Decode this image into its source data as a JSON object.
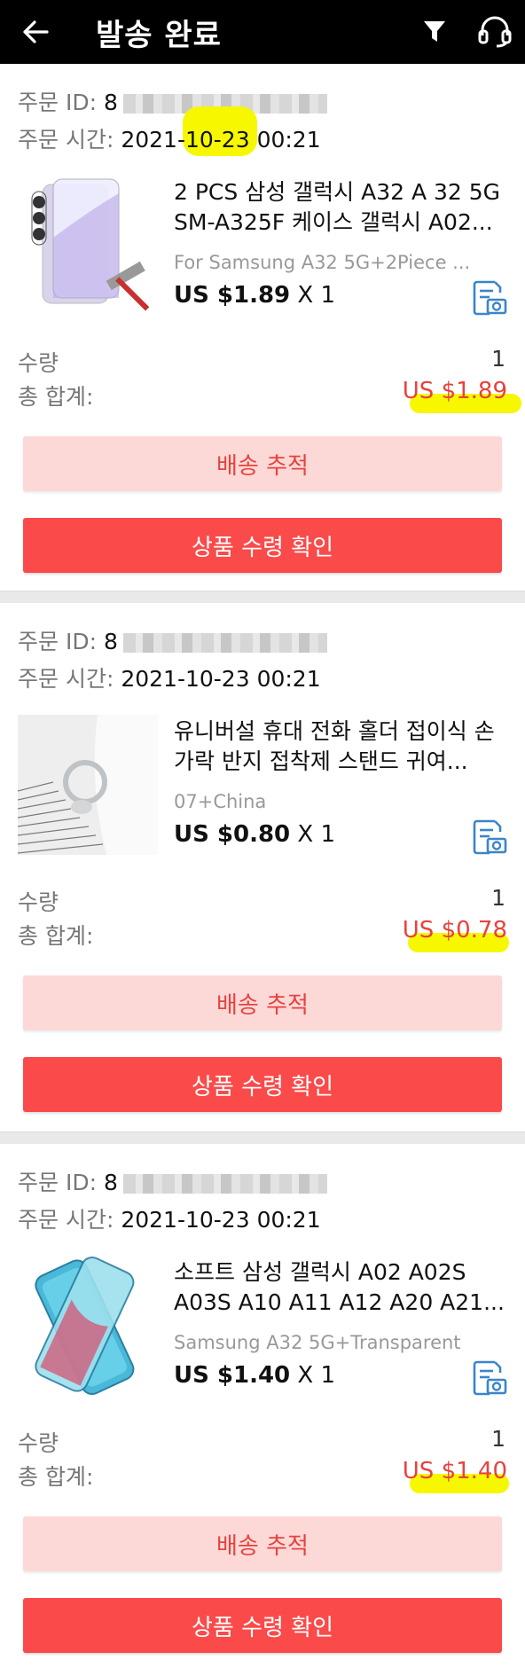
{
  "header": {
    "title": "발송 완료",
    "icons": [
      "back-arrow-icon",
      "filter-icon",
      "headset-icon"
    ]
  },
  "labels": {
    "order_id": "주문 ID:",
    "order_time": "주문 시간:",
    "quantity": "수량",
    "total": "총 합계:",
    "track_button": "배송 추적",
    "confirm_button": "상품 수령 확인"
  },
  "orders": [
    {
      "order_id_prefix": "8",
      "order_time": "2021-10-23 00:21",
      "product_name": "2 PCS 삼성 갤럭시 A32 A 32 5G SM-A325F 케이스 갤럭시 A02...",
      "variant": "For Samsung A32 5G+2Piece ...",
      "unit_price": "US $1.89",
      "multiplier": " X 1",
      "quantity": "1",
      "total": "US $1.89"
    },
    {
      "order_id_prefix": "8",
      "order_time": "2021-10-23 00:21",
      "product_name": "유니버설 휴대 전화 홀더 접이식 손가락 반지 접착제 스탠드 귀여...",
      "variant": "07+China",
      "unit_price": "US $0.80",
      "multiplier": " X 1",
      "quantity": "1",
      "total": "US $0.78"
    },
    {
      "order_id_prefix": "8",
      "order_time": "2021-10-23 00:21",
      "product_name": "소프트 삼성 갤럭시 A02 A02S A03S A10 A11 A12 A20 A21...",
      "variant": "Samsung A32 5G+Transparent",
      "unit_price": "US $1.40",
      "multiplier": " X 1",
      "quantity": "1",
      "total": "US $1.40"
    }
  ],
  "colors": {
    "accent": "#fa4a4a",
    "accent_light": "#fcd9d7",
    "price_red": "#e8423e",
    "highlight": "#f7f700",
    "header_bg": "#000000"
  }
}
